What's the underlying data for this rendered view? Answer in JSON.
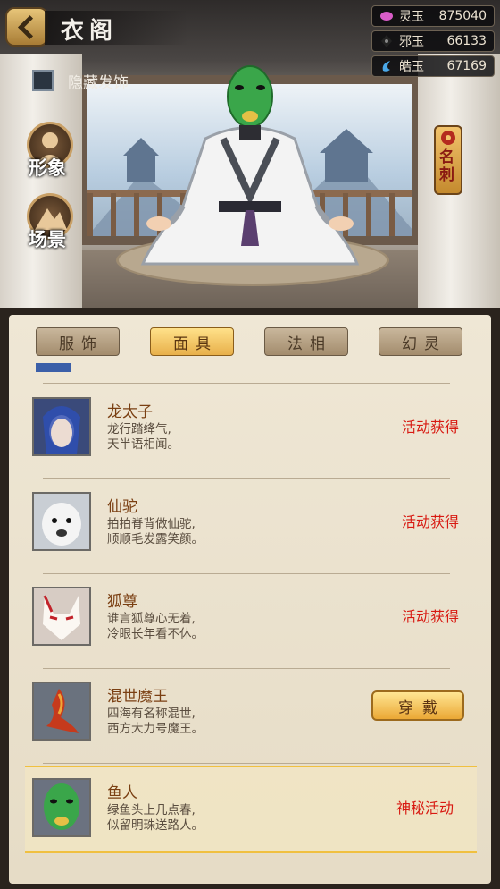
{
  "header": {
    "title": "衣阁"
  },
  "currencies": [
    {
      "name": "灵玉",
      "value": "875040",
      "icon": "spirit-jade-icon",
      "color": "#d85cc8"
    },
    {
      "name": "邪玉",
      "value": "66133",
      "icon": "evil-jade-icon",
      "color": "#222222"
    },
    {
      "name": "皓玉",
      "value": "67169",
      "icon": "bright-jade-icon",
      "color": "#4aa8e8"
    }
  ],
  "options": {
    "hide_accessory_label": "隐藏发饰",
    "hide_accessory_checked": false
  },
  "side_menu": {
    "appearance": "形象",
    "scene": "场景",
    "name_card": "名刺"
  },
  "tabs": [
    {
      "label": "服饰",
      "active": false
    },
    {
      "label": "面具",
      "active": true
    },
    {
      "label": "法相",
      "active": false
    },
    {
      "label": "幻灵",
      "active": false
    }
  ],
  "items": [
    {
      "name": "龙太子",
      "line1": "龙行踏绛气,",
      "line2": "天半语相闻。",
      "status": "活动获得",
      "action": "",
      "thumb": "dragon-prince-mask-icon"
    },
    {
      "name": "仙驼",
      "line1": "拍拍脊背做仙驼,",
      "line2": "顺顺毛发露笑颜。",
      "status": "活动获得",
      "action": "",
      "thumb": "alpaca-mask-icon"
    },
    {
      "name": "狐尊",
      "line1": "谁言狐尊心无着,",
      "line2": "冷眼长年看不休。",
      "status": "活动获得",
      "action": "",
      "thumb": "fox-mask-icon"
    },
    {
      "name": "混世魔王",
      "line1": "四海有名称混世,",
      "line2": "西方大力号魔王。",
      "status": "",
      "action": "穿戴",
      "thumb": "demon-king-mask-icon"
    },
    {
      "name": "鱼人",
      "line1": "绿鱼头上几点春,",
      "line2": "似留明珠送路人。",
      "status": "神秘活动",
      "action": "",
      "thumb": "fishman-mask-icon",
      "selected": true
    }
  ]
}
